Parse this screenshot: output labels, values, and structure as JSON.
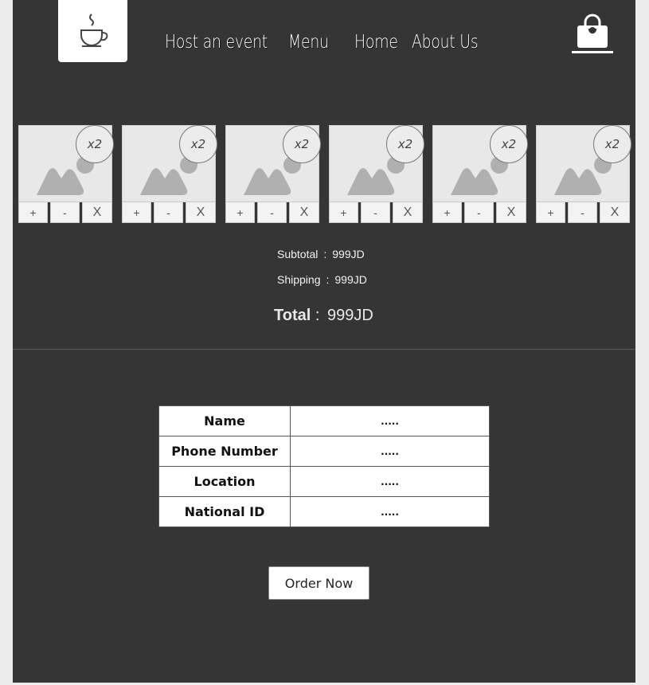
{
  "nav": {
    "links": [
      "Host an event",
      "Menu",
      "Home",
      "About Us"
    ]
  },
  "items": [
    {
      "qty": "x2",
      "plus": "+",
      "minus": "-",
      "remove": "X"
    },
    {
      "qty": "x2",
      "plus": "+",
      "minus": "-",
      "remove": "X"
    },
    {
      "qty": "x2",
      "plus": "+",
      "minus": "-",
      "remove": "X"
    },
    {
      "qty": "x2",
      "plus": "+",
      "minus": "-",
      "remove": "X"
    },
    {
      "qty": "x2",
      "plus": "+",
      "minus": "-",
      "remove": "X"
    },
    {
      "qty": "x2",
      "plus": "+",
      "minus": "-",
      "remove": "X"
    }
  ],
  "summary": {
    "subtotal_label": "Subtotal",
    "subtotal_value": "999JD",
    "shipping_label": "Shipping",
    "shipping_value": "999JD",
    "separator": ":",
    "total_label": "Total",
    "total_sep": ":",
    "total_value": "999JD"
  },
  "form": {
    "rows": [
      {
        "label": "Name",
        "value": "....."
      },
      {
        "label": "Phone Number",
        "value": "....."
      },
      {
        "label": "Location",
        "value": "....."
      },
      {
        "label": "National ID",
        "value": "....."
      }
    ]
  },
  "order_button": "Order Now",
  "colors": {
    "page_bg": "#353535",
    "outer_bg": "#ececec",
    "text": "#ffffff"
  }
}
